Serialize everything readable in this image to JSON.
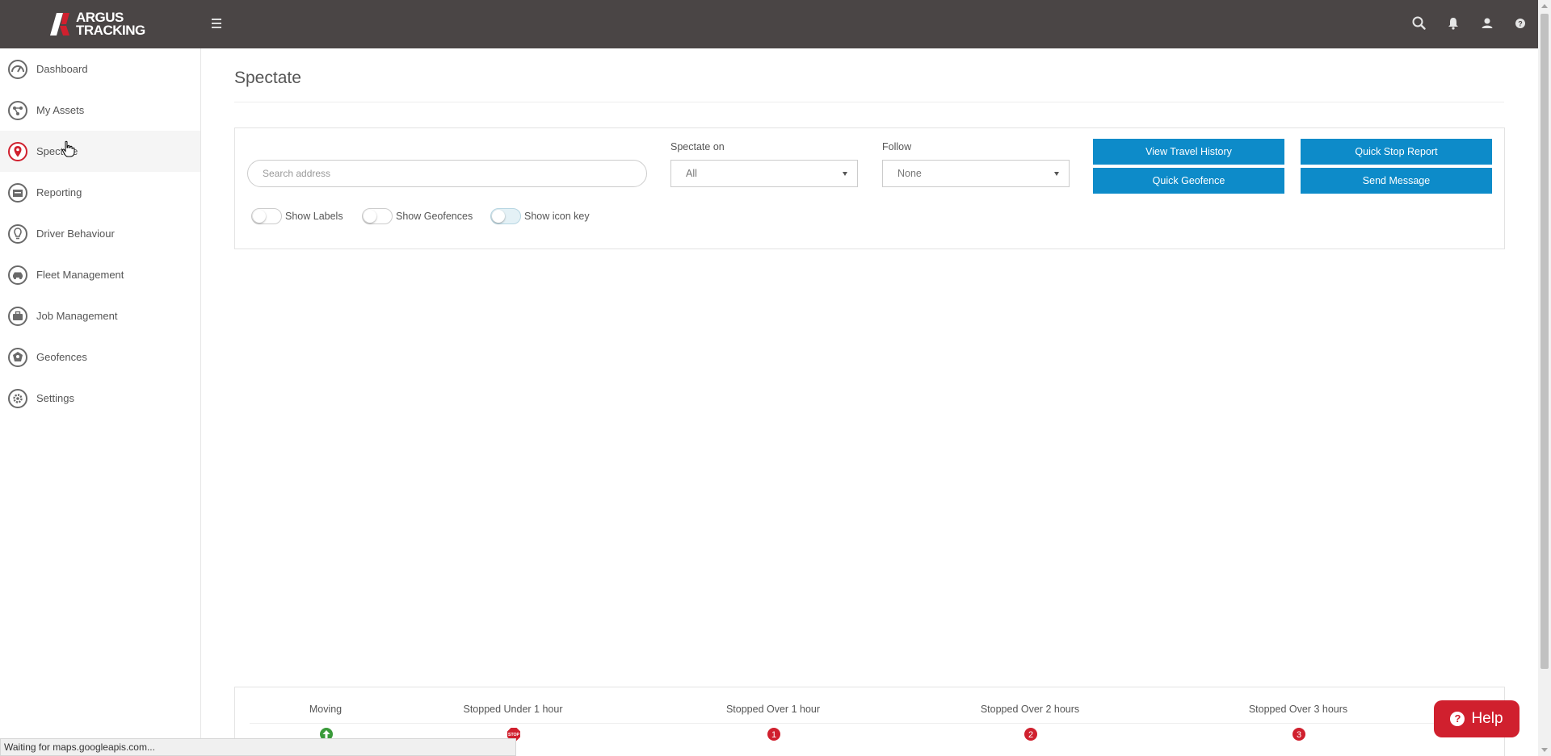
{
  "header": {
    "logo": {
      "line1": "ARGUS",
      "line2": "TRACKING"
    },
    "icons": [
      "menu-icon",
      "search-icon",
      "bell-icon",
      "user-icon",
      "question-icon"
    ]
  },
  "sidebar": {
    "items": [
      {
        "label": "Dashboard",
        "icon": "gauge-icon",
        "active": false
      },
      {
        "label": "My Assets",
        "icon": "assets-icon",
        "active": false
      },
      {
        "label": "Spectate",
        "icon": "map-pin-icon",
        "active": true
      },
      {
        "label": "Reporting",
        "icon": "report-icon",
        "active": false
      },
      {
        "label": "Driver Behaviour",
        "icon": "lightbulb-icon",
        "active": false
      },
      {
        "label": "Fleet Management",
        "icon": "car-icon",
        "active": false
      },
      {
        "label": "Job Management",
        "icon": "briefcase-icon",
        "active": false
      },
      {
        "label": "Geofences",
        "icon": "geofence-icon",
        "active": false
      },
      {
        "label": "Settings",
        "icon": "gear-icon",
        "active": false
      }
    ]
  },
  "page": {
    "title": "Spectate"
  },
  "controls": {
    "search_placeholder": "Search address",
    "spectate_on": {
      "label": "Spectate on",
      "value": "All"
    },
    "follow": {
      "label": "Follow",
      "value": "None"
    },
    "buttons": {
      "view_travel_history": "View Travel History",
      "quick_stop_report": "Quick Stop Report",
      "quick_geofence": "Quick Geofence",
      "send_message": "Send Message"
    },
    "toggles": {
      "show_labels": "Show Labels",
      "show_geofences": "Show Geofences",
      "show_icon_key": "Show icon key"
    }
  },
  "legend": {
    "items": [
      {
        "label": "Moving",
        "marker": "arrow-up-icon",
        "marker_text": "",
        "color": "#3a9a3a"
      },
      {
        "label": "Stopped Under 1 hour",
        "marker": "stop-sign-icon",
        "marker_text": "STOP",
        "color": "#d0202e"
      },
      {
        "label": "Stopped Over 1 hour",
        "marker": "number-pin-icon",
        "marker_text": "1",
        "color": "#d0202e"
      },
      {
        "label": "Stopped Over 2 hours",
        "marker": "number-pin-icon",
        "marker_text": "2",
        "color": "#d0202e"
      },
      {
        "label": "Stopped Over 3 hours",
        "marker": "number-pin-icon",
        "marker_text": "3",
        "color": "#d0202e"
      }
    ]
  },
  "help": {
    "label": "Help"
  },
  "status_bar": {
    "text": "Waiting for maps.googleapis.com..."
  },
  "colors": {
    "topbar": "#4a4545",
    "primary_button": "#0d8bc9",
    "help_button": "#d0202e",
    "active_nav_icon": "#d0202e"
  }
}
